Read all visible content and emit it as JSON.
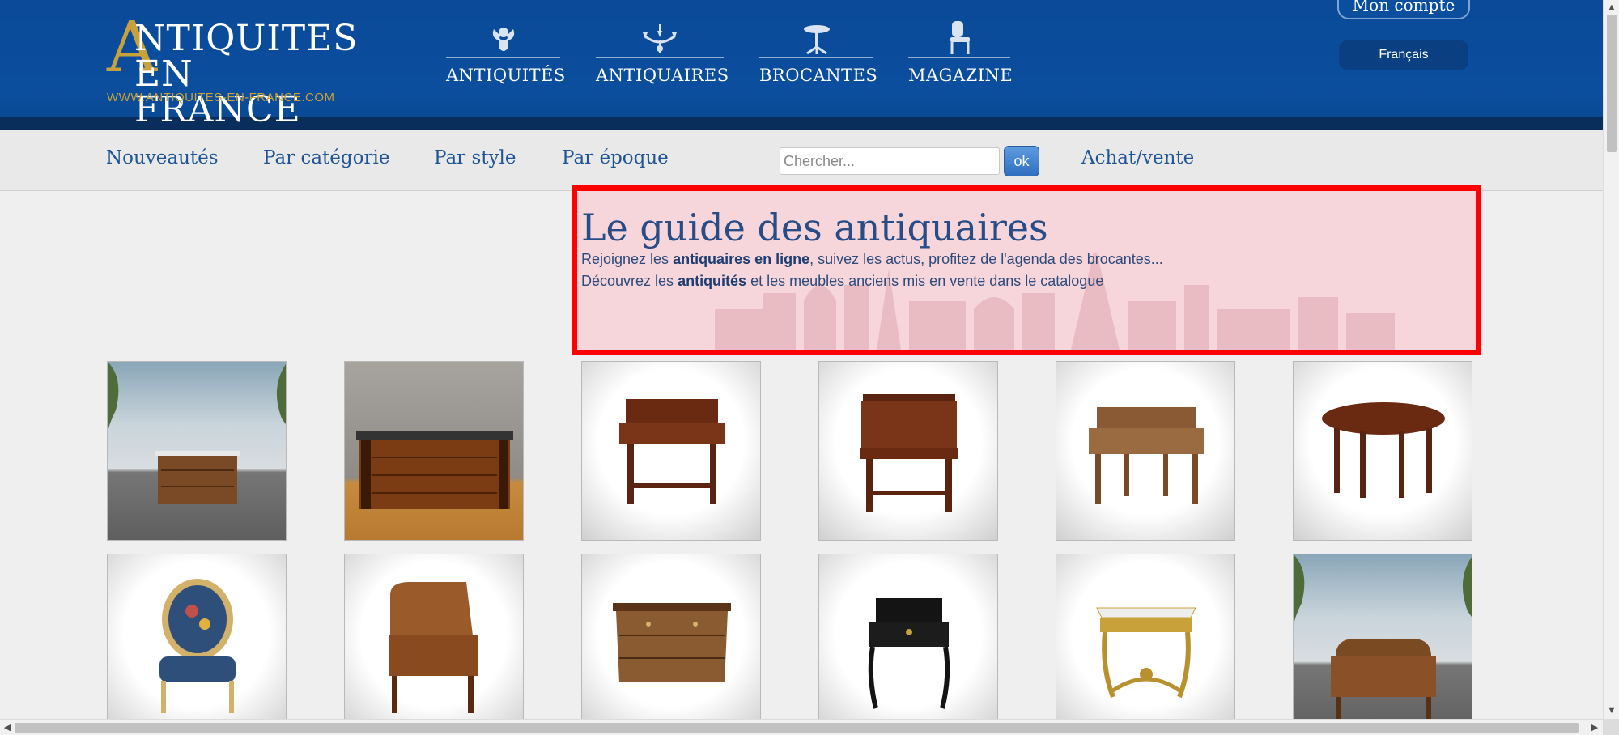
{
  "logo": {
    "big_letter": "A",
    "line1": "NTIQUITES",
    "line2": "EN FRANCE",
    "url": "WWW.ANTIQUITES-EN-FRANCE.COM"
  },
  "topnav": [
    {
      "label": "ANTIQUITÉS",
      "icon": "cherub-icon"
    },
    {
      "label": "ANTIQUAIRES",
      "icon": "chandelier-icon"
    },
    {
      "label": "BROCANTES",
      "icon": "pedestal-table-icon"
    },
    {
      "label": "MAGAZINE",
      "icon": "chair-icon"
    }
  ],
  "account": {
    "label": "Mon compte"
  },
  "language": {
    "label": "Français"
  },
  "subnav": {
    "items": [
      "Nouveautés",
      "Par catégorie",
      "Par style",
      "Par époque"
    ],
    "search_placeholder": "Chercher...",
    "ok_label": "ok",
    "achat_vente": "Achat/vente"
  },
  "guide": {
    "title": "Le guide des antiquaires",
    "line1_pre": "Rejoignez les ",
    "line1_bold": "antiquaires en ligne",
    "line1_post": ", suivez les actus, profitez de l'agenda des brocantes...",
    "line2_pre": "Découvrez les ",
    "line2_bold": "antiquités",
    "line2_post": " et les meubles anciens mis en vente dans le catalogue"
  },
  "products": [
    {
      "item": "commode-marble-top",
      "background": "backdrop"
    },
    {
      "item": "empire-commode",
      "background": "wall"
    },
    {
      "item": "writing-desk",
      "background": "studio"
    },
    {
      "item": "gallery-desk",
      "background": "studio"
    },
    {
      "item": "bureau-plat",
      "background": "studio"
    },
    {
      "item": "round-table",
      "background": "studio"
    },
    {
      "item": "upholstered-armchair",
      "background": "studio"
    },
    {
      "item": "cylinder-desk",
      "background": "studio"
    },
    {
      "item": "marquetry-commode",
      "background": "studio"
    },
    {
      "item": "black-lacquer-desk",
      "background": "studio"
    },
    {
      "item": "gilt-console",
      "background": "studio"
    },
    {
      "item": "cylinder-bureau",
      "background": "backdrop"
    }
  ],
  "colors": {
    "header_blue": "#0b4e9e",
    "gold": "#c9a13a",
    "link_blue": "#1f5594",
    "highlight_border": "#ff0000",
    "highlight_fill": "#f6d6da"
  }
}
